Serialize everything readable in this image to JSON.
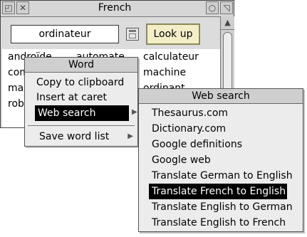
{
  "window": {
    "title": "French",
    "input_value": "ordinateur",
    "lookup_label": "Look up",
    "titlebar_icons": {
      "back": "back-icon",
      "close": "close-icon",
      "iconise": "iconise-icon",
      "toggle_size": "toggle-size-icon"
    }
  },
  "results": {
    "col1": [
      "androïde",
      "com",
      "mar",
      "robo"
    ],
    "col2": [
      "automate"
    ],
    "col3": [
      "calculateur",
      "machine",
      "ordinant"
    ]
  },
  "word_menu": {
    "title": "Word",
    "items": [
      "Copy to clipboard",
      "Insert at caret",
      "Web search",
      "Save word list"
    ]
  },
  "web_menu": {
    "title": "Web search",
    "items": [
      "Thesaurus.com",
      "Dictionary.com",
      "Google definitions",
      "Google web",
      "Translate German to English",
      "Translate French to English",
      "Translate English to German",
      "Translate English to French"
    ],
    "selected_index": 5
  },
  "colors": {
    "lookup_bg": "#f4eec8",
    "selected_bg": "#000000",
    "menu_bg": "#ececec"
  }
}
